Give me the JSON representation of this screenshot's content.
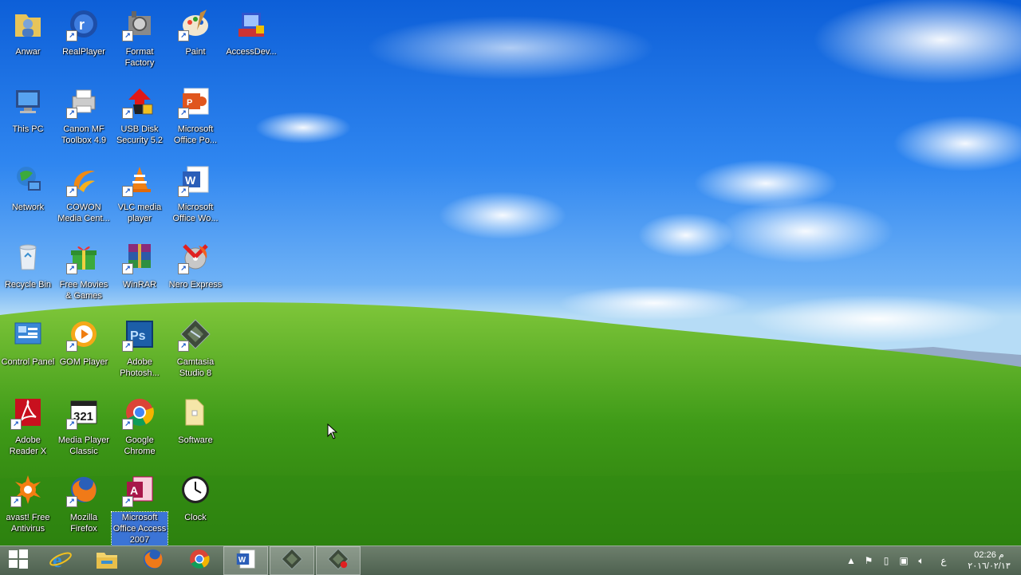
{
  "desktop": {
    "icons": [
      {
        "label": "Anwar",
        "name": "user-folder-icon"
      },
      {
        "label": "RealPlayer",
        "name": "realplayer-icon"
      },
      {
        "label": "Format Factory",
        "name": "format-factory-icon"
      },
      {
        "label": "Paint",
        "name": "paint-icon"
      },
      {
        "label": "AccessDev...",
        "name": "accessdev-icon"
      },
      {
        "label": "This PC",
        "name": "computer-icon"
      },
      {
        "label": "Canon MF Toolbox 4.9",
        "name": "canon-printer-icon"
      },
      {
        "label": "USB Disk Security 5.2",
        "name": "usb-security-icon"
      },
      {
        "label": "Microsoft Office Po...",
        "name": "powerpoint-icon"
      },
      {
        "label": "Network",
        "name": "network-icon"
      },
      {
        "label": "COWON Media Cent...",
        "name": "cowon-icon"
      },
      {
        "label": "VLC media player",
        "name": "vlc-icon"
      },
      {
        "label": "Microsoft Office Wo...",
        "name": "word-icon"
      },
      {
        "label": "Recycle Bin",
        "name": "recycle-bin-icon"
      },
      {
        "label": "Free Movies & Games",
        "name": "gift-icon"
      },
      {
        "label": "WinRAR",
        "name": "winrar-icon"
      },
      {
        "label": "Nero Express",
        "name": "nero-icon"
      },
      {
        "label": "Control Panel",
        "name": "control-panel-icon"
      },
      {
        "label": "GOM Player",
        "name": "gom-player-icon"
      },
      {
        "label": "Adobe Photosh...",
        "name": "photoshop-icon"
      },
      {
        "label": "Camtasia Studio 8",
        "name": "camtasia-icon"
      },
      {
        "label": "Adobe Reader X",
        "name": "adobe-reader-icon"
      },
      {
        "label": "Media Player Classic",
        "name": "media-player-classic-icon"
      },
      {
        "label": "Google Chrome",
        "name": "chrome-icon"
      },
      {
        "label": "Software",
        "name": "folder-icon"
      },
      {
        "label": "avast! Free Antivirus",
        "name": "avast-icon"
      },
      {
        "label": "Mozilla Firefox",
        "name": "firefox-icon"
      },
      {
        "label": "Microsoft Office Access 2007",
        "name": "access-icon"
      },
      {
        "label": "Clock",
        "name": "clock-icon"
      }
    ]
  },
  "taskbar": {
    "buttons": [
      "start-icon",
      "internet-explorer-icon",
      "file-explorer-icon",
      "firefox-icon",
      "chrome-icon",
      "word-icon",
      "camtasia-icon",
      "camtasia-recorder-icon"
    ],
    "tray": {
      "language": "ع",
      "time": "02:26 م",
      "date": "٢٠١٦/٠٢/١٣"
    }
  },
  "colors": {
    "sky": "#2f86f0",
    "grass": "#4aa11d",
    "taskbar": "#5c6f5d",
    "selection": "#3b74d6"
  }
}
